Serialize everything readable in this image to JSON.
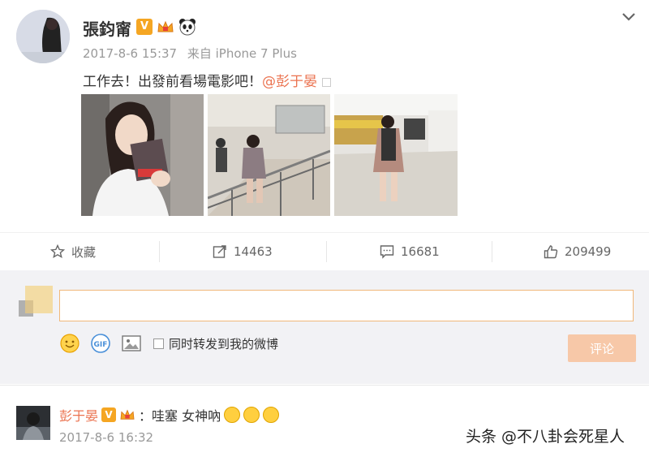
{
  "post": {
    "author": "張鈞甯",
    "verified_badge": "V",
    "date": "2017-8-6 15:37",
    "source": "来自 iPhone 7 Plus",
    "text": "工作去！出發前看場電影吧！",
    "mention": "@彭于晏"
  },
  "actions": {
    "favorite_label": "收藏",
    "repost_count": "14463",
    "comment_count": "16681",
    "like_count": "209499"
  },
  "composer": {
    "input_value": "",
    "forward_label": "同时转发到我的微博",
    "submit_label": "评论",
    "gif_label": "GIF"
  },
  "reply": {
    "user": "彭于晏",
    "verified_badge": "V",
    "text": "：哇塞 女神吶",
    "time": "2017-8-6 16:32"
  },
  "watermark": "头条 @不八卦会死星人",
  "colors": {
    "accent": "#eb7350",
    "badge": "#f5a623",
    "submit_disabled": "#f7c8a8"
  }
}
